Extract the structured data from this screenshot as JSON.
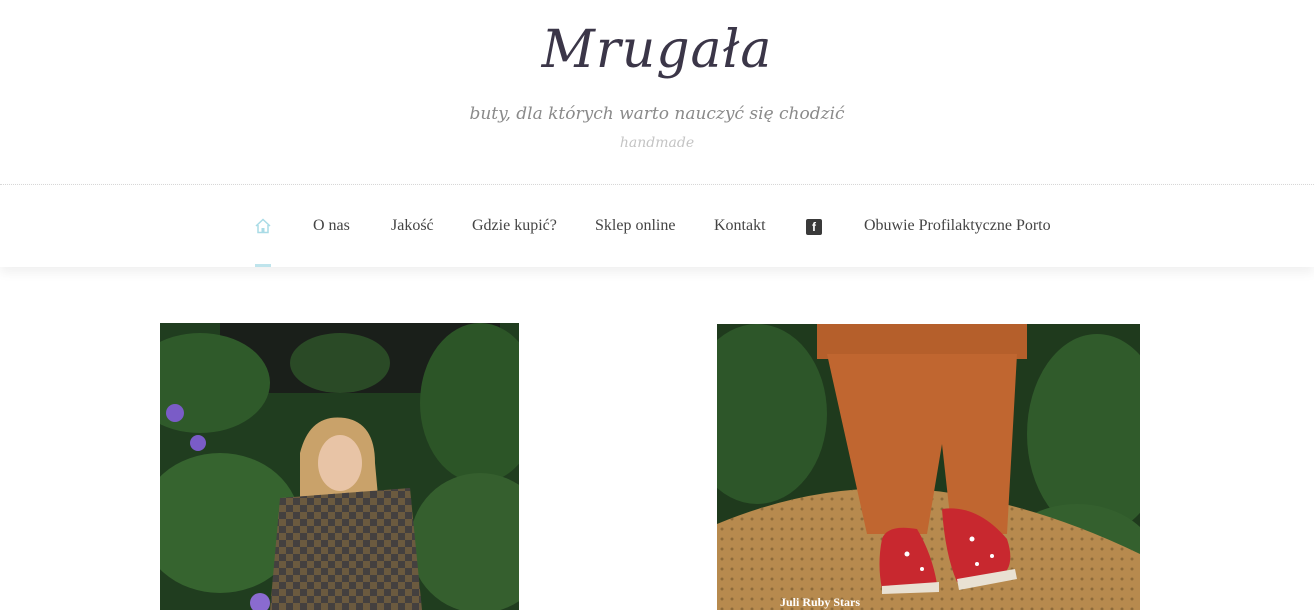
{
  "header": {
    "logo_text": "Mrugała",
    "tagline": "buty, dla których warto nauczyć się chodzić",
    "subtagline": "handmade"
  },
  "nav": {
    "home_icon": "home-icon",
    "items": [
      {
        "label": "O nas"
      },
      {
        "label": "Jakość"
      },
      {
        "label": "Gdzie kupić?"
      },
      {
        "label": "Sklep online"
      },
      {
        "label": "Kontakt"
      },
      {
        "label": "Obuwie Profilaktyczne Porto"
      }
    ],
    "facebook_icon": "facebook-icon",
    "facebook_glyph": "f",
    "active_color": "#bfe4ec"
  },
  "gallery": {
    "items": [
      {
        "caption": ""
      },
      {
        "caption": "Juli Ruby Stars"
      }
    ]
  }
}
